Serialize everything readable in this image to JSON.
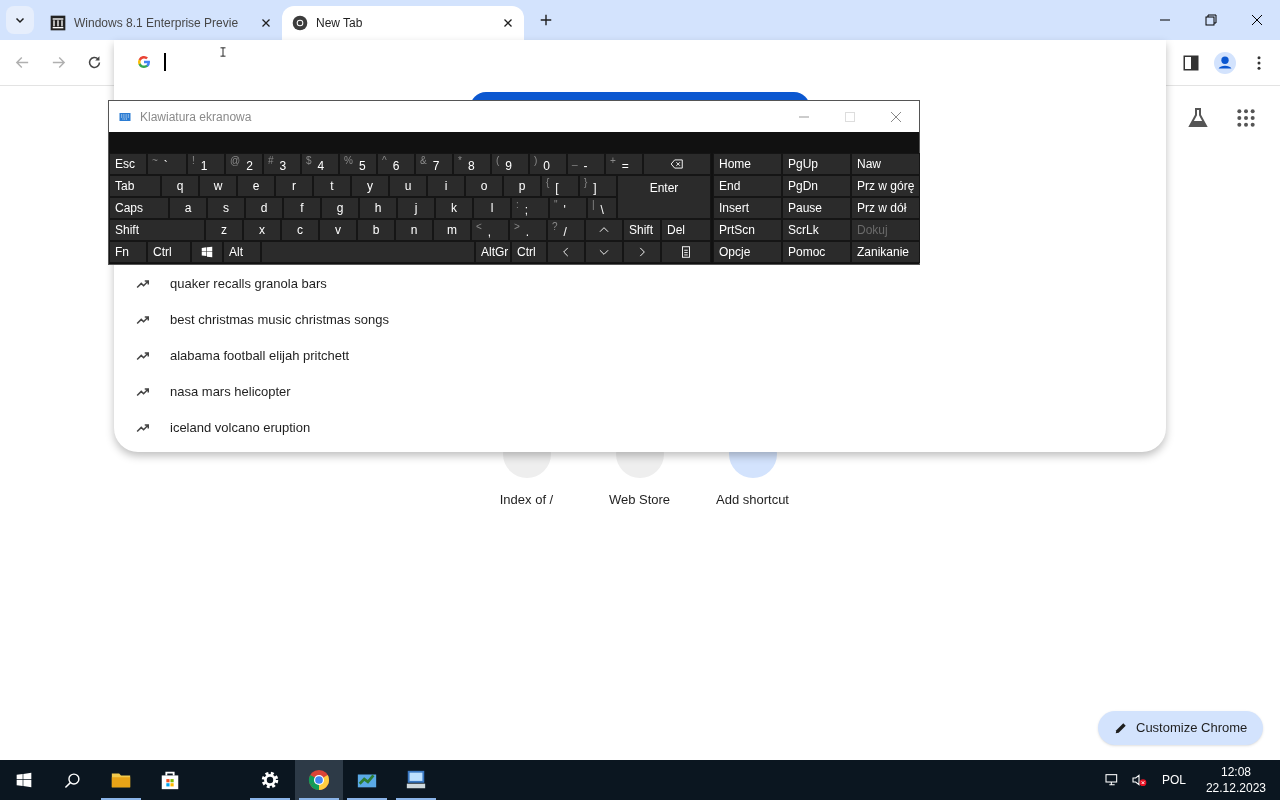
{
  "tabs": [
    {
      "title": "Windows 8.1 Enterprise Previe",
      "selected": false
    },
    {
      "title": "New Tab",
      "selected": true
    }
  ],
  "omnibox": {
    "caret": true
  },
  "suggestions": [
    "quaker recalls granola bars",
    "best christmas music christmas songs",
    "alabama football elijah pritchett",
    "nasa mars helicopter",
    "iceland volcano eruption"
  ],
  "shortcuts": [
    "Index of /",
    "Web Store",
    "Add shortcut"
  ],
  "customize_button": "Customize Chrome",
  "keyboard": {
    "title": "Klawiatura ekranowa",
    "rows": [
      {
        "keys": [
          {
            "kind": "key",
            "label": "Esc"
          },
          {
            "kind": "key",
            "label": "`",
            "shift": "~"
          },
          {
            "kind": "key",
            "label": "1",
            "shift": "!"
          },
          {
            "kind": "key",
            "label": "2",
            "shift": "@"
          },
          {
            "kind": "key",
            "label": "3",
            "shift": "#"
          },
          {
            "kind": "key",
            "label": "4",
            "shift": "$"
          },
          {
            "kind": "key",
            "label": "5",
            "shift": "%"
          },
          {
            "kind": "key",
            "label": "6",
            "shift": "^"
          },
          {
            "kind": "key",
            "label": "7",
            "shift": "&"
          },
          {
            "kind": "key",
            "label": "8",
            "shift": "*"
          },
          {
            "kind": "key",
            "label": "9",
            "shift": "("
          },
          {
            "kind": "key",
            "label": "0",
            "shift": ")"
          },
          {
            "kind": "key",
            "label": "-",
            "shift": "_"
          },
          {
            "kind": "key",
            "label": "=",
            "shift": "+"
          },
          {
            "kind": "backspace"
          }
        ]
      },
      {
        "keys": [
          {
            "kind": "key",
            "label": "Tab"
          },
          {
            "kind": "key",
            "label": "q"
          },
          {
            "kind": "key",
            "label": "w"
          },
          {
            "kind": "key",
            "label": "e"
          },
          {
            "kind": "key",
            "label": "r"
          },
          {
            "kind": "key",
            "label": "t"
          },
          {
            "kind": "key",
            "label": "y"
          },
          {
            "kind": "key",
            "label": "u"
          },
          {
            "kind": "key",
            "label": "i"
          },
          {
            "kind": "key",
            "label": "o"
          },
          {
            "kind": "key",
            "label": "p"
          },
          {
            "kind": "key",
            "label": "[",
            "shift": "{"
          },
          {
            "kind": "key",
            "label": "]",
            "shift": "}"
          },
          {
            "kind": "enter",
            "label": "Enter"
          }
        ]
      },
      {
        "keys": [
          {
            "kind": "key",
            "label": "Caps"
          },
          {
            "kind": "key",
            "label": "a"
          },
          {
            "kind": "key",
            "label": "s"
          },
          {
            "kind": "key",
            "label": "d"
          },
          {
            "kind": "key",
            "label": "f"
          },
          {
            "kind": "key",
            "label": "g"
          },
          {
            "kind": "key",
            "label": "h"
          },
          {
            "kind": "key",
            "label": "j"
          },
          {
            "kind": "key",
            "label": "k"
          },
          {
            "kind": "key",
            "label": "l"
          },
          {
            "kind": "key",
            "label": ";",
            "shift": ":"
          },
          {
            "kind": "key",
            "label": "'",
            "shift": "\""
          },
          {
            "kind": "key",
            "label": "\\",
            "shift": "|"
          }
        ]
      },
      {
        "keys": [
          {
            "kind": "key",
            "label": "Shift"
          },
          {
            "kind": "key",
            "label": "z"
          },
          {
            "kind": "key",
            "label": "x"
          },
          {
            "kind": "key",
            "label": "c"
          },
          {
            "kind": "key",
            "label": "v"
          },
          {
            "kind": "key",
            "label": "b"
          },
          {
            "kind": "key",
            "label": "n"
          },
          {
            "kind": "key",
            "label": "m"
          },
          {
            "kind": "key",
            "label": ",",
            "shift": "<"
          },
          {
            "kind": "key",
            "label": ".",
            "shift": ">"
          },
          {
            "kind": "key",
            "label": "/",
            "shift": "?"
          },
          {
            "kind": "up"
          },
          {
            "kind": "key",
            "label": "Shift"
          },
          {
            "kind": "key",
            "label": "Del"
          }
        ]
      },
      {
        "keys": [
          {
            "kind": "key",
            "label": "Fn"
          },
          {
            "kind": "key",
            "label": "Ctrl"
          },
          {
            "kind": "windows"
          },
          {
            "kind": "key",
            "label": "Alt"
          },
          {
            "kind": "space"
          },
          {
            "kind": "key",
            "label": "AltGr"
          },
          {
            "kind": "key",
            "label": "Ctrl"
          },
          {
            "kind": "left"
          },
          {
            "kind": "down"
          },
          {
            "kind": "right"
          },
          {
            "kind": "menu"
          }
        ]
      }
    ],
    "nav": [
      {
        "keys": [
          {
            "label": "Home",
            "disabled": false
          },
          {
            "label": "PgUp",
            "disabled": false
          },
          {
            "label": "Naw",
            "disabled": false
          }
        ]
      },
      {
        "keys": [
          {
            "label": "End",
            "disabled": false
          },
          {
            "label": "PgDn",
            "disabled": false
          },
          {
            "label": "Prz w górę",
            "disabled": false
          }
        ]
      },
      {
        "keys": [
          {
            "label": "Insert",
            "disabled": false
          },
          {
            "label": "Pause",
            "disabled": false
          },
          {
            "label": "Prz w dół",
            "disabled": false
          }
        ]
      },
      {
        "keys": [
          {
            "label": "PrtScn",
            "disabled": false
          },
          {
            "label": "ScrLk",
            "disabled": false
          },
          {
            "label": "Dokuj",
            "disabled": true
          }
        ]
      },
      {
        "keys": [
          {
            "label": "Opcje",
            "disabled": false
          },
          {
            "label": "Pomoc",
            "disabled": false
          },
          {
            "label": "Zanikanie",
            "disabled": false
          }
        ]
      }
    ]
  },
  "taskbar": {
    "apps": [
      {
        "running": true,
        "selected": false
      },
      {
        "running": false,
        "selected": false
      },
      {
        "running": true,
        "selected": false
      },
      {
        "running": true,
        "selected": true
      },
      {
        "running": true,
        "selected": false
      },
      {
        "running": true,
        "selected": false
      }
    ],
    "language": "POL",
    "time": "12:08",
    "date": "22.12.2023"
  }
}
